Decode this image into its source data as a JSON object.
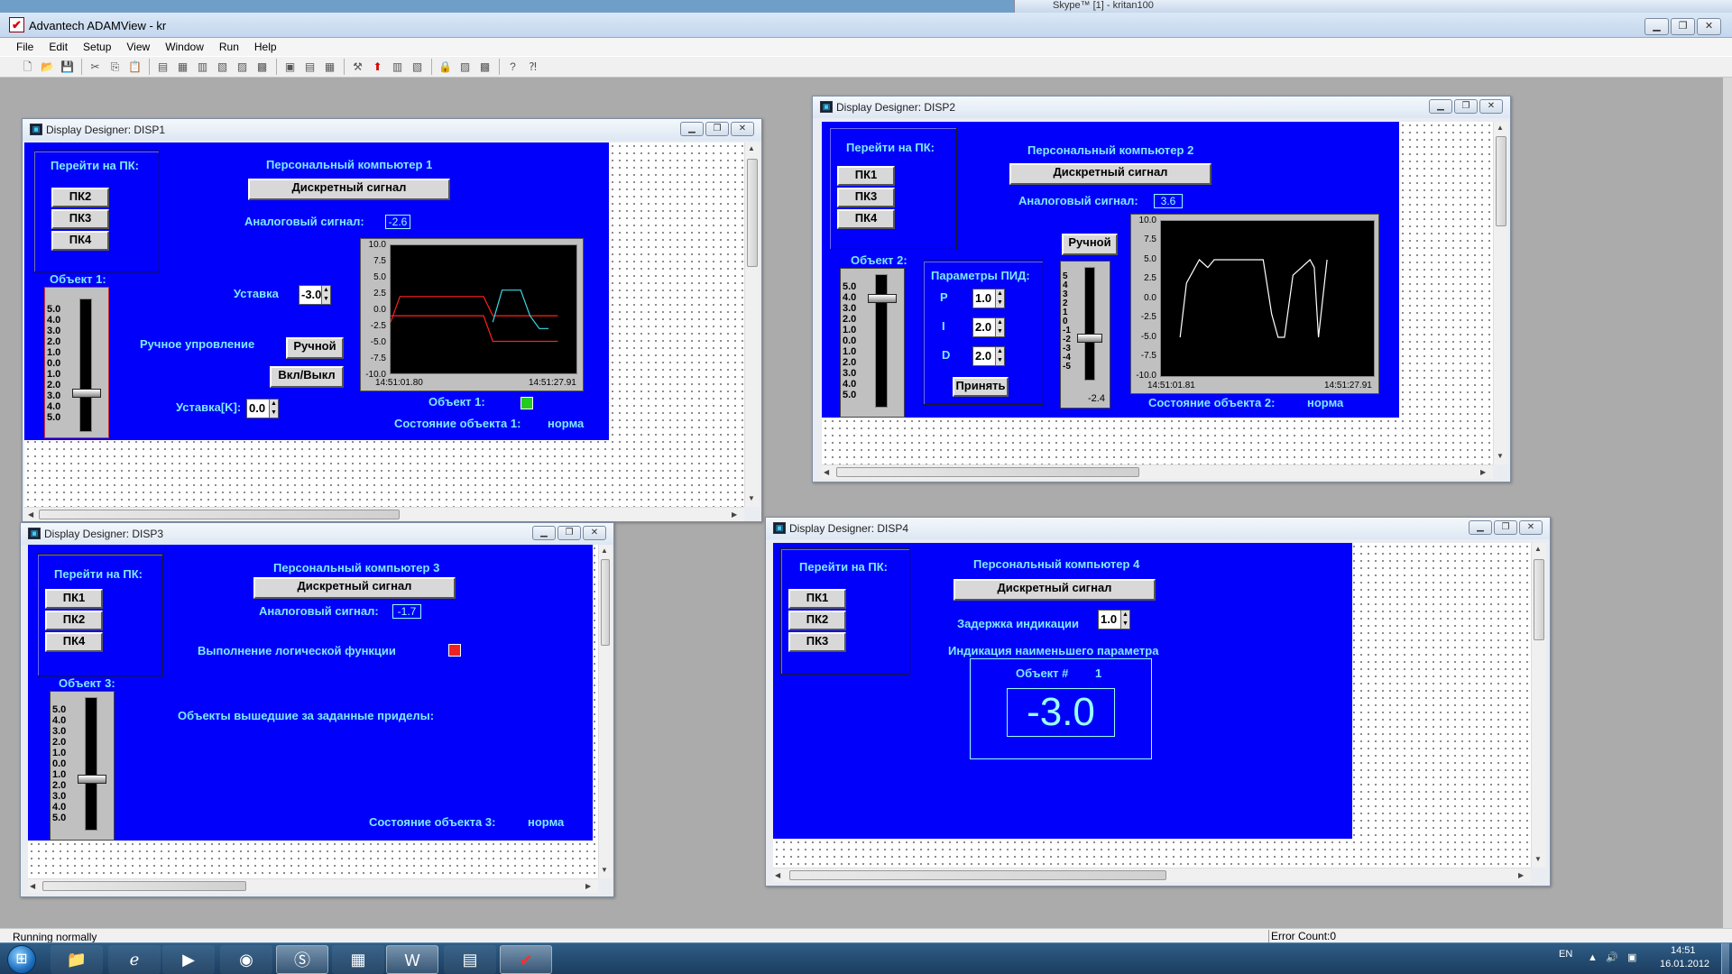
{
  "app": {
    "title": "Advantech ADAMView - kr",
    "menu": [
      "File",
      "Edit",
      "Setup",
      "View",
      "Window",
      "Run",
      "Help"
    ],
    "background_title": "Skype™ [1] - kritan100",
    "status": "Running normally",
    "error_count": "Error Count:0"
  },
  "colors": {
    "panel_blue": "#0000fb",
    "label_cyan": "#7fe8ff",
    "led_green": "#22cc22",
    "led_red": "#ee2222",
    "trend_red": "#ff2020",
    "trend_cyan": "#3fd9e6",
    "trend_white": "#ffffff"
  },
  "disp1": {
    "title": "Display Designer: DISP1",
    "goto_label": "Перейти на ПК:",
    "goto_buttons": [
      "ПК2",
      "ПК3",
      "ПК4"
    ],
    "pc_title": "Персональный компьютер  1",
    "discrete_button": "Дискретный сигнал",
    "analog_label": "Аналоговый сигнал:",
    "analog_value": "-2.6",
    "object_label": "Объект 1:",
    "slider_scale": "5.0\n4.0\n3.0\n2.0\n1.0\n0.0\n1.0\n2.0\n3.0\n4.0\n5.0",
    "setpoint_label": "Уставка",
    "setpoint_value": "-3.0",
    "manual_label": "Ручное упровление",
    "manual_button": "Ручной",
    "onoff_button": "Вкл/Выкл",
    "setpoint_k_label": "Уставка[K]:",
    "setpoint_k_value": "0.0",
    "led_label": "Объект 1:",
    "state_label": "Состояние объекта 1:",
    "state_value": "норма"
  },
  "disp2": {
    "title": "Display Designer: DISP2",
    "goto_label": "Перейти на ПК:",
    "goto_buttons": [
      "ПК1",
      "ПК3",
      "ПК4"
    ],
    "pc_title": "Персональный компьютер  2",
    "discrete_button": "Дискретный сигнал",
    "analog_label": "Аналоговый сигнал:",
    "analog_value": "3.6",
    "object_label": "Объект 2:",
    "slider_scale": "5.0\n4.0\n3.0\n2.0\n1.0\n0.0\n1.0\n2.0\n3.0\n4.0\n5.0",
    "pid_label": "Параметры ПИД:",
    "pid": [
      {
        "name": "P",
        "value": "1.0"
      },
      {
        "name": "I",
        "value": "2.0"
      },
      {
        "name": "D",
        "value": "2.0"
      }
    ],
    "accept_button": "Принять",
    "manual_button": "Ручной",
    "manual_scale": "5\n4\n3\n2\n1\n0\n-1\n-2\n-3\n-4\n-5",
    "manual_value": "-2.4",
    "state_label": "Состояние объекта 2:",
    "state_value": "норма"
  },
  "disp3": {
    "title": "Display Designer: DISP3",
    "goto_label": "Перейти на ПК:",
    "goto_buttons": [
      "ПК1",
      "ПК2",
      "ПК4"
    ],
    "pc_title": "Персональный компьютер 3",
    "discrete_button": "Дискретный сигнал",
    "analog_label": "Аналоговый сигнал:",
    "analog_value": "-1.7",
    "logic_label": "Выполнение логической функции",
    "object_label": "Объект 3:",
    "slider_scale": "5.0\n4.0\n3.0\n2.0\n1.0\n0.0\n1.0\n2.0\n3.0\n4.0\n5.0",
    "limits_label": "Объекты вышедшие за заданные приделы:",
    "state_label": "Состояние объекта 3:",
    "state_value": "норма"
  },
  "disp4": {
    "title": "Display Designer: DISP4",
    "goto_label": "Перейти на ПК:",
    "goto_buttons": [
      "ПК1",
      "ПК2",
      "ПК3"
    ],
    "pc_title": "Персональный компьютер  4",
    "discrete_button": "Дискретный сигнал",
    "delay_label": "Задержка индикации",
    "delay_value": "1.0",
    "min_label": "Индикация наименьшего параметра",
    "obj_num_label": "Объект #",
    "obj_num_value": "1",
    "big_value": "-3.0"
  },
  "chart_data": [
    {
      "type": "line",
      "ylim": [
        -10,
        10
      ],
      "yticks": [
        "10.0",
        "7.5",
        "5.0",
        "2.5",
        "0.0",
        "-2.5",
        "-5.0",
        "-7.5",
        "-10.0"
      ],
      "xticks": [
        "14:51:01.80",
        "14:51:27.91"
      ],
      "x": [
        0,
        0.05,
        0.1,
        0.2,
        0.3,
        0.35,
        0.4,
        0.45,
        0.5,
        0.55,
        0.6,
        0.65,
        0.7,
        0.75,
        0.8,
        0.85,
        0.9,
        0.95,
        1.0
      ],
      "series": [
        {
          "values": [
            -2,
            2,
            2,
            2,
            2,
            2,
            2,
            2,
            2,
            -1,
            -1,
            -1,
            -1,
            -1,
            -1,
            -1,
            -1,
            null,
            null
          ],
          "color": "#ff2020"
        },
        {
          "values": [
            -1,
            -1,
            -1,
            -1,
            -1,
            -1,
            -1,
            -1,
            -1,
            -5,
            -5,
            -5,
            -5,
            -5,
            -5,
            -5,
            -5,
            null,
            null
          ],
          "color": "#ff2020"
        },
        {
          "values": [
            null,
            null,
            null,
            null,
            null,
            null,
            null,
            null,
            null,
            -2,
            3,
            3,
            3,
            -1,
            -3,
            -3,
            null,
            null,
            null
          ],
          "color": "#3fd9e6"
        }
      ]
    },
    {
      "type": "line",
      "ylim": [
        -10,
        10
      ],
      "yticks": [
        "10.0",
        "7.5",
        "5.0",
        "2.5",
        "0.0",
        "-2.5",
        "-5.0",
        "-7.5",
        "-10.0"
      ],
      "xticks": [
        "14:51:01.81",
        "14:51:27.91"
      ],
      "x": [
        0,
        0.09,
        0.12,
        0.18,
        0.22,
        0.25,
        0.3,
        0.4,
        0.48,
        0.52,
        0.55,
        0.58,
        0.62,
        0.66,
        0.7,
        0.72,
        0.74,
        0.78,
        0.82
      ],
      "series": [
        {
          "values": [
            null,
            -5,
            2,
            5,
            4,
            5,
            5,
            5,
            5,
            -2,
            -5,
            -5,
            3,
            4,
            5,
            4,
            -5,
            5,
            null
          ],
          "color": "#ffffff"
        }
      ]
    }
  ]
}
